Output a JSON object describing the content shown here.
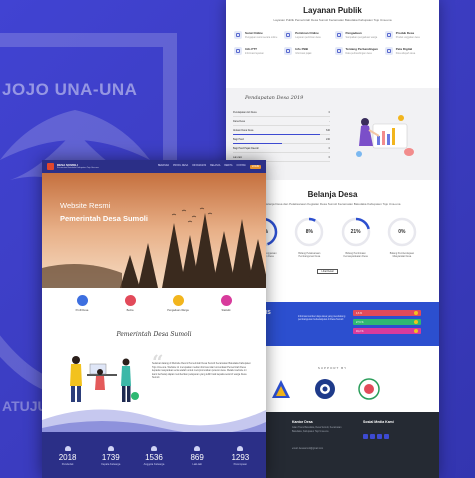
{
  "background": {
    "text_top": "JOJO UNA-UNA",
    "text_bottom": "ATUJU",
    "color": "#3e3fc7"
  },
  "back_page": {
    "layanan": {
      "title": "Layanan Publik",
      "subtitle": "Layanan Publik Pemerintah Desa Sumoli Kecamatan Batudaka Kabupaten Tojo Una-una",
      "services": [
        {
          "name": "Surat Online",
          "desc": "Pengajuan surat secara online",
          "icon": "document-icon"
        },
        {
          "name": "Perizinan Online",
          "desc": "Layanan perizinan desa",
          "icon": "stamp-icon"
        },
        {
          "name": "Pengaduan",
          "desc": "Sampaikan pengaduan warga",
          "icon": "chat-icon"
        },
        {
          "name": "Produk Desa",
          "desc": "Produk unggulan desa",
          "icon": "bag-icon"
        },
        {
          "name": "Info PTT",
          "desc": "Informasi layanan",
          "icon": "info-icon"
        },
        {
          "name": "Info PBB",
          "desc": "Informasi pajak",
          "icon": "receipt-icon"
        },
        {
          "name": "Tentang Perbandingan",
          "desc": "Data perbandingan desa",
          "icon": "chart-icon"
        },
        {
          "name": "Peta Digital",
          "desc": "Peta wilayah desa",
          "icon": "map-icon"
        }
      ]
    },
    "pendapatan": {
      "title": "Pendapatan Desa 2019",
      "rows": [
        {
          "label": "Pendapatan Asli Desa",
          "value": "0",
          "fill": 0.0
        },
        {
          "label": "Dana Desa",
          "value": "-",
          "fill": 0.0
        },
        {
          "label": "Alokasi Dana Desa",
          "value": "640",
          "fill": 0.9
        },
        {
          "label": "Bagi Hasil",
          "value": "240",
          "fill": 0.5
        },
        {
          "label": "Bagi Hasil Pajak Daerah",
          "value": "0",
          "fill": 0.0
        },
        {
          "label": "Lain-lain",
          "value": "0",
          "fill": 0.0
        }
      ]
    },
    "belanja": {
      "title": "Belanja Desa",
      "subtitle": "Belanja Desa dan Pelaksanaan Kegiatan Desa Sumoli Kecamatan Batudaka Kabupaten Tojo Una-una",
      "items": [
        {
          "value": "44%",
          "fill": 0.44,
          "label": "Bidang Penyelenggaraan Pemerintahan Desa"
        },
        {
          "value": "8%",
          "fill": 0.08,
          "label": "Bidang Pelaksanaan Pembangunan Desa"
        },
        {
          "value": "21%",
          "fill": 0.21,
          "label": "Bidang Pembinaan Kemasyarakatan Desa"
        },
        {
          "value": "0%",
          "fill": 0.0,
          "label": "Bidang Pemberdayaan Masyarakat Desa"
        }
      ],
      "button": "Lihat Detail"
    },
    "sdgs": {
      "title": "IS",
      "paragraph": "Informasi sumber daya desa yang mendukung pembangunan berkelanjutan di Desa Sumoli",
      "bars": [
        {
          "label": "4,6 %",
          "color": "#e24a5a"
        },
        {
          "label": "27,6 %",
          "color": "#2eb872"
        },
        {
          "label": "46,2 %",
          "color": "#d83b9c"
        }
      ]
    },
    "support": {
      "title": "SUPPORT BY"
    },
    "footer": {
      "col1_title": "Kantor Desa",
      "col1_text": "Jalan Trans Batudaka, Desa Sumoli, Kecamatan Batudaka, Kabupaten Tojo Una-una",
      "col1_email": "email: desasumoli@gmail.com",
      "col2_title": "Sosial Media Kami"
    }
  },
  "front_page": {
    "nav": {
      "brand": "DESA SUMOLI",
      "brand_sub": "Kecamatan Batudaka Kabupaten Tojo Una-una",
      "menu": [
        "BERANDA",
        "PROFIL DESA",
        "INFOGRAFIS",
        "BELANJA",
        "BERITA",
        "KONTAK",
        "LOGIN"
      ]
    },
    "hero": {
      "line1": "Website Resmi",
      "line2": "Pemerintah Desa Sumoli"
    },
    "quick_links": [
      {
        "label": "Profil Desa",
        "color": "#3d6fe0",
        "icon": "profile-icon"
      },
      {
        "label": "Berita",
        "color": "#e24a5a",
        "icon": "news-icon"
      },
      {
        "label": "Pengaduan Warga",
        "color": "#f2b51d",
        "icon": "complaint-icon"
      },
      {
        "label": "Statistik",
        "color": "#d83b9c",
        "icon": "stats-icon"
      }
    ],
    "pemerintah": {
      "title": "Pemerintah Desa Sumoli",
      "paragraph": "Selamat datang di Website Resmi Pemerintah Desa Sumoli Kecamatan Batudaka Kabupaten Tojo Una-una. Website ini merupakan media informasi dan komunikasi Pemerintah Desa kepada masyarakat serta wadah untuk mempromosikan potensi desa. Melalui website ini kami berharap dapat memberikan pelayanan yang lebih baik kepada seluruh warga Desa Sumoli."
    },
    "stats": [
      {
        "value": "2018",
        "label": "Penduduk"
      },
      {
        "value": "1739",
        "label": "Kepala Keluarga"
      },
      {
        "value": "1536",
        "label": "Anggota Keluarga"
      },
      {
        "value": "869",
        "label": "Laki-laki"
      },
      {
        "value": "1293",
        "label": "Perempuan"
      }
    ]
  }
}
